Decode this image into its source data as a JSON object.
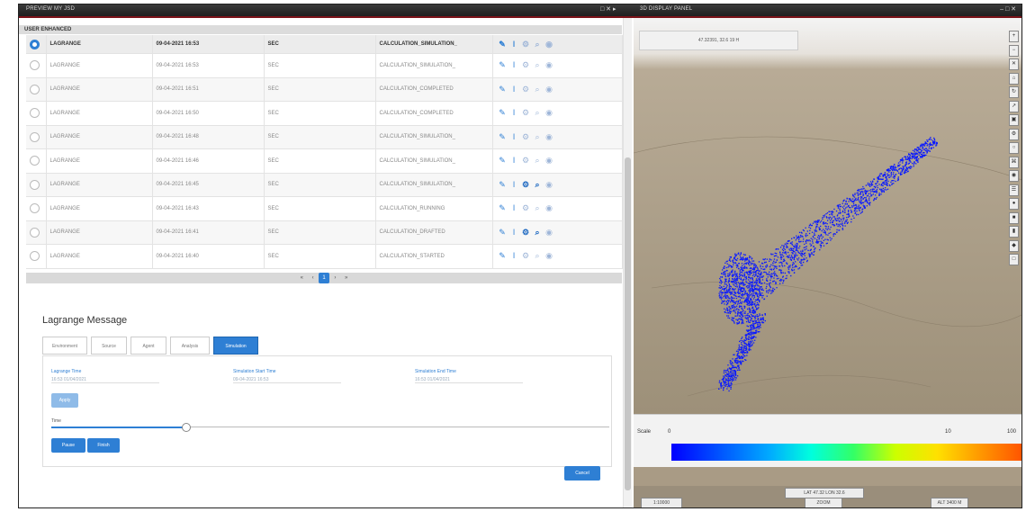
{
  "window": {
    "left_title": "PREVIEW MY JSD",
    "right_title": "3D DISPLAY PANEL",
    "left_controls": "□ ✕ ▸",
    "right_controls": "– □ ✕"
  },
  "grid": {
    "section_title": "USER ENHANCED",
    "columns": [
      "LAGRANGE",
      "09-04-2021 16:53",
      "SEC",
      "CALCULATION_SIMULATION_"
    ],
    "rows": [
      {
        "type": "LAGRANGE",
        "date": "09-04-2021 16:53",
        "unit": "SEC",
        "status": "CALCULATION_SIMULATION_"
      },
      {
        "type": "LAGRANGE",
        "date": "09-04-2021 16:51",
        "unit": "SEC",
        "status": "CALCULATION_COMPLETED"
      },
      {
        "type": "LAGRANGE",
        "date": "09-04-2021 16:50",
        "unit": "SEC",
        "status": "CALCULATION_COMPLETED"
      },
      {
        "type": "LAGRANGE",
        "date": "09-04-2021 16:48",
        "unit": "SEC",
        "status": "CALCULATION_SIMULATION_"
      },
      {
        "type": "LAGRANGE",
        "date": "09-04-2021 16:46",
        "unit": "SEC",
        "status": "CALCULATION_SIMULATION_"
      },
      {
        "type": "LAGRANGE",
        "date": "09-04-2021 16:45",
        "unit": "SEC",
        "status": "CALCULATION_SIMULATION_"
      },
      {
        "type": "LAGRANGE",
        "date": "09-04-2021 16:43",
        "unit": "SEC",
        "status": "CALCULATION_RUNNING"
      },
      {
        "type": "LAGRANGE",
        "date": "09-04-2021 16:41",
        "unit": "SEC",
        "status": "CALCULATION_DRAFTED"
      },
      {
        "type": "LAGRANGE",
        "date": "09-04-2021 16:40",
        "unit": "SEC",
        "status": "CALCULATION_STARTED"
      }
    ],
    "pager": {
      "prev": "‹",
      "first": "«",
      "current": "1",
      "next": "›",
      "last": "»"
    }
  },
  "lagrange": {
    "title": "Lagrange Message",
    "tabs": [
      "Environment",
      "Source",
      "Agent",
      "Analysis",
      "Simulation"
    ],
    "active_tab": "Simulation",
    "fields": [
      {
        "label": "Lagrange Time",
        "value": "16:53 01/04/2021"
      },
      {
        "label": "Simulation Start Time",
        "value": "09-04-2021 16:53"
      },
      {
        "label": "Simulation End Time",
        "value": "16:53 01/04/2021"
      }
    ],
    "apply_label": "Apply",
    "slider_label": "Time",
    "slider_value": 0.22,
    "pause_label": "Pause",
    "finish_label": "Finish",
    "cancel_label": "Cancel"
  },
  "map": {
    "coord_text": "47.32391, 32.6 19 H",
    "tools": [
      "+",
      "−",
      "✕",
      "⌂",
      "↻",
      "↗",
      "▣",
      "⚙",
      "○",
      "⌘",
      "◉",
      "☰",
      "●",
      "■",
      "▮",
      "◆",
      "□"
    ],
    "legend": {
      "title": "Scale",
      "min_tick": "0",
      "mid_tick": "10",
      "max_tick": "100"
    },
    "status_buttons": [
      "1:10000",
      "LAT 47.32 LON 32.6",
      "ZOOM",
      "ALT 3400 M"
    ],
    "colors": {
      "plume": "#0a1aff",
      "accent": "#2e7fd4",
      "terrain": "#a99b85"
    }
  }
}
